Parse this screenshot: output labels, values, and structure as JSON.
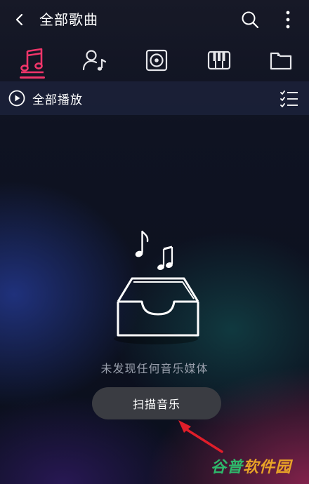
{
  "header": {
    "title": "全部歌曲",
    "back_icon": "chevron-left-icon",
    "search_icon": "search-icon",
    "more_icon": "more-vertical-icon"
  },
  "tabs": [
    {
      "icon": "music-note-icon",
      "active": true
    },
    {
      "icon": "artist-icon",
      "active": false
    },
    {
      "icon": "album-icon",
      "active": false
    },
    {
      "icon": "piano-icon",
      "active": false
    },
    {
      "icon": "folder-icon",
      "active": false
    }
  ],
  "playbar": {
    "play_all_label": "全部播放",
    "play_icon": "play-circle-icon",
    "list_icon": "checklist-icon"
  },
  "empty_state": {
    "message": "未发现任何音乐媒体",
    "scan_button_label": "扫描音乐"
  },
  "watermark": {
    "part_a": "谷普",
    "part_b": "软件园"
  },
  "colors": {
    "accent": "#f0356a",
    "annotation_arrow": "#e01e2a",
    "button_bg": "#3a3c42",
    "text_muted": "#9aa0ad"
  }
}
